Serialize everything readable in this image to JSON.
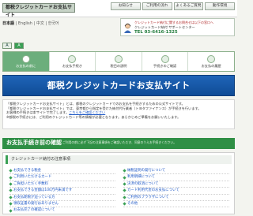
{
  "header": {
    "site_title": "都税クレジットカードお支払サイト",
    "nav": [
      "お知らせ",
      "ご利用の流れ",
      "よくあるご質問",
      "動作環境"
    ]
  },
  "language": {
    "current": "日本語",
    "others": [
      "English",
      "中文",
      "한국어"
    ]
  },
  "support": {
    "line1": "クレジットカード納付に関するお問合せは以下の窓口へ",
    "line2": "クレジットカード納付 サポートセンター",
    "phone": "TEL 03-6416-1325"
  },
  "font_size": {
    "options": [
      "A",
      "A"
    ],
    "selected_index": 1
  },
  "tabs": [
    {
      "label": "お支払の前に"
    },
    {
      "label": "お支払手続き"
    },
    {
      "label": "税目の説明"
    },
    {
      "label": "手続きのご確認"
    },
    {
      "label": "お支払の履歴"
    }
  ],
  "active_tab_index": 0,
  "hero": {
    "title": "都税クレジットカードお支払サイト"
  },
  "intro": {
    "p1": "「都税クレジットカードお支払サイト」とは、都税のクレジットカードでのお支払を手続きするための公式サイトです。",
    "p2": "「都税クレジットカードお支払サイト」では、東京都から指定を受けた納付代行業者（トヨタファイナンス）が手続きを行います。",
    "p3": "お客様の手続きは本サイトで完了します。",
    "link": "こちらをご確認ください",
    "p4": "※都税の手続きには、ご利用のクレジットカード等の情報が必要となります。あらかじめご準備をお願いいたします。"
  },
  "procedure": {
    "title": "お支払手続き前の確認",
    "note": "ご利用の前に必ず下記の注意事項をご確認いただき、同意のうえお手続きください。"
  },
  "info": {
    "header": "クレジットカード納付の注意事項",
    "left": [
      "お支払できる税金",
      "ご利用いただけるカード",
      "ご負担いただく手数料",
      "お支払できる金額は100万円未満です",
      "お支払期限が迫っている方",
      "領収証書の発行はありません",
      "お支払完了の確認について"
    ],
    "right": [
      "納税証明の発行について",
      "利用明細について",
      "決済の取消について",
      "カード利用代金のお支払について",
      "ご利用のブラウザについて",
      "その他"
    ]
  }
}
